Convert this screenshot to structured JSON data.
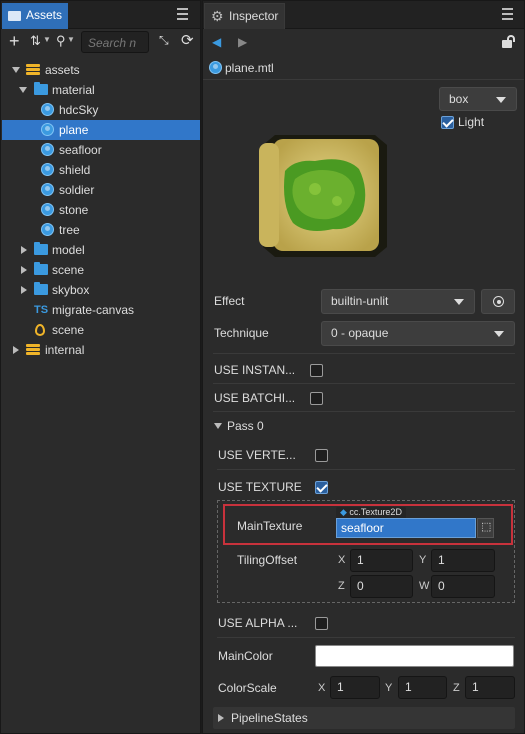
{
  "assets_panel": {
    "tab_label": "Assets",
    "search_placeholder": "Search n",
    "tree": [
      {
        "label": "assets",
        "icon": "database-icon",
        "expanded": true
      },
      {
        "label": "material",
        "icon": "folder-icon",
        "expanded": true
      },
      {
        "label": "hdcSky",
        "icon": "material-icon"
      },
      {
        "label": "plane",
        "icon": "material-icon",
        "selected": true
      },
      {
        "label": "seafloor",
        "icon": "material-icon"
      },
      {
        "label": "shield",
        "icon": "material-icon"
      },
      {
        "label": "soldier",
        "icon": "material-icon"
      },
      {
        "label": "stone",
        "icon": "material-icon"
      },
      {
        "label": "tree",
        "icon": "material-icon"
      },
      {
        "label": "model",
        "icon": "folder-icon",
        "expanded": false
      },
      {
        "label": "scene",
        "icon": "folder-icon",
        "expanded": false
      },
      {
        "label": "skybox",
        "icon": "folder-icon",
        "expanded": false
      },
      {
        "label": "migrate-canvas",
        "icon": "typescript-icon",
        "icon_text": "TS"
      },
      {
        "label": "scene",
        "icon": "scene-fire-icon"
      },
      {
        "label": "internal",
        "icon": "database-icon",
        "expanded": false
      }
    ]
  },
  "inspector": {
    "tab_label": "Inspector",
    "file_name": "plane.mtl",
    "preview": {
      "mesh": "box",
      "light_label": "Light",
      "light_checked": true
    },
    "effect": {
      "label": "Effect",
      "value": "builtin-unlit"
    },
    "technique": {
      "label": "Technique",
      "value": "0 - opaque"
    },
    "use_instancing": {
      "label": "USE INSTAN...",
      "checked": false
    },
    "use_batching": {
      "label": "USE BATCHI...",
      "checked": false
    },
    "pass_label": "Pass 0",
    "use_vertex": {
      "label": "USE VERTE...",
      "checked": false
    },
    "use_texture": {
      "label": "USE TEXTURE",
      "checked": true
    },
    "main_texture": {
      "label": "MainTexture",
      "type": "cc.Texture2D",
      "value": "seafloor"
    },
    "tiling_offset": {
      "label": "TilingOffset",
      "x_label": "X",
      "x": "1",
      "y_label": "Y",
      "y": "1",
      "z_label": "Z",
      "z": "0",
      "w_label": "W",
      "w": "0"
    },
    "use_alpha": {
      "label": "USE ALPHA ...",
      "checked": false
    },
    "main_color": {
      "label": "MainColor",
      "color": "#ffffff"
    },
    "color_scale": {
      "label": "ColorScale",
      "x_label": "X",
      "x": "1",
      "y_label": "Y",
      "y": "1",
      "z_label": "Z",
      "z": "1"
    },
    "pipeline_states_label": "PipelineStates"
  },
  "colors": {
    "accent": "#3177c9",
    "highlight_border": "#c8323c",
    "grass": "#3f8f1f",
    "sand": "#d9c87a"
  }
}
